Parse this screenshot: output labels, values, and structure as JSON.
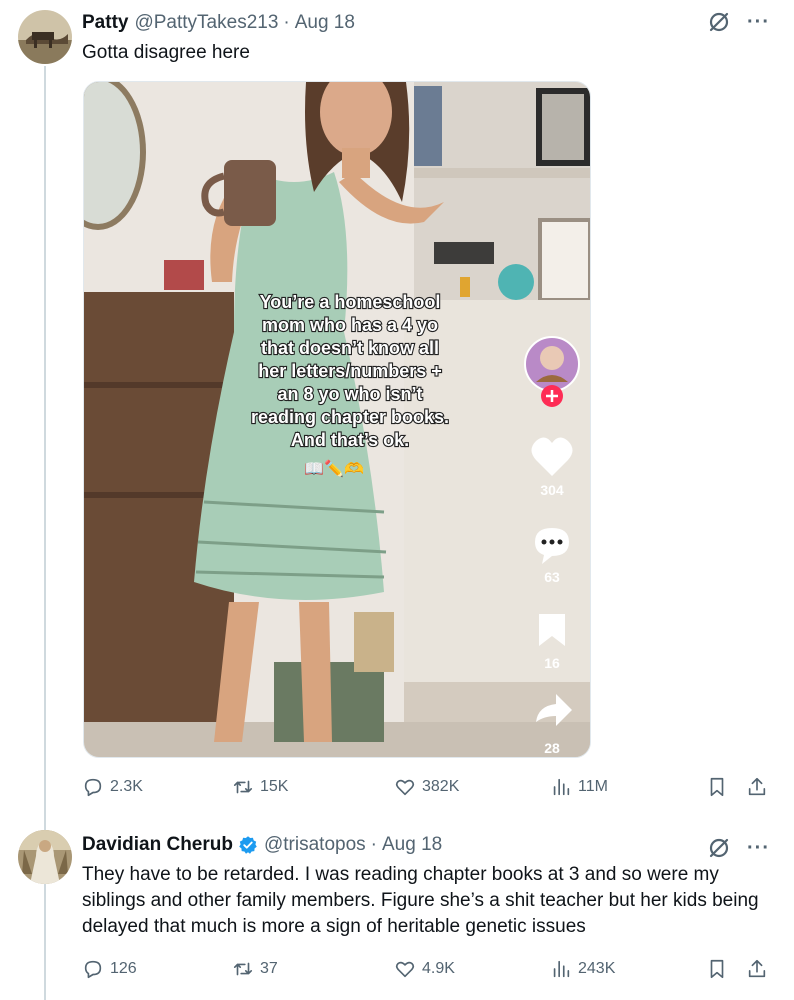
{
  "tweets": [
    {
      "display_name": "Patty",
      "handle": "@PattyTakes213",
      "separator": "·",
      "date": "Aug 18",
      "text": "Gotta disagree here",
      "media": {
        "caption_lines": [
          "You’re a homeschool",
          "mom who has a 4 yo",
          "that doesn’t know all",
          "her letters/numbers +",
          "an 8 yo who isn’t",
          "reading chapter books.",
          "And that’s ok."
        ],
        "emoji_line": "📖✏️🫶",
        "likes": "304",
        "comments": "63",
        "saves": "16",
        "shares": "28"
      },
      "stats": {
        "replies": "2.3K",
        "reposts": "15K",
        "likes": "382K",
        "views": "11M"
      }
    },
    {
      "display_name": "Davidian Cherub",
      "handle": "@trisatopos",
      "separator": "·",
      "date": "Aug 18",
      "text": "They have to be retarded. I was reading chapter books at 3 and so were my siblings and other family members. Figure she’s a shit teacher but her kids being delayed that much is more a sign of heritable genetic issues",
      "stats": {
        "replies": "126",
        "reposts": "37",
        "likes": "4.9K",
        "views": "243K"
      }
    }
  ],
  "colors": {
    "text": "#0f1419",
    "secondary": "#536471",
    "verified": "#1d9bf0",
    "thread_line": "#cfd9de",
    "tiktok_plus": "#fe2c55"
  },
  "icons": [
    "reply-icon",
    "repost-icon",
    "like-icon",
    "views-icon",
    "bookmark-icon",
    "share-icon",
    "grok-icon",
    "more-icon",
    "verified-badge-icon"
  ]
}
